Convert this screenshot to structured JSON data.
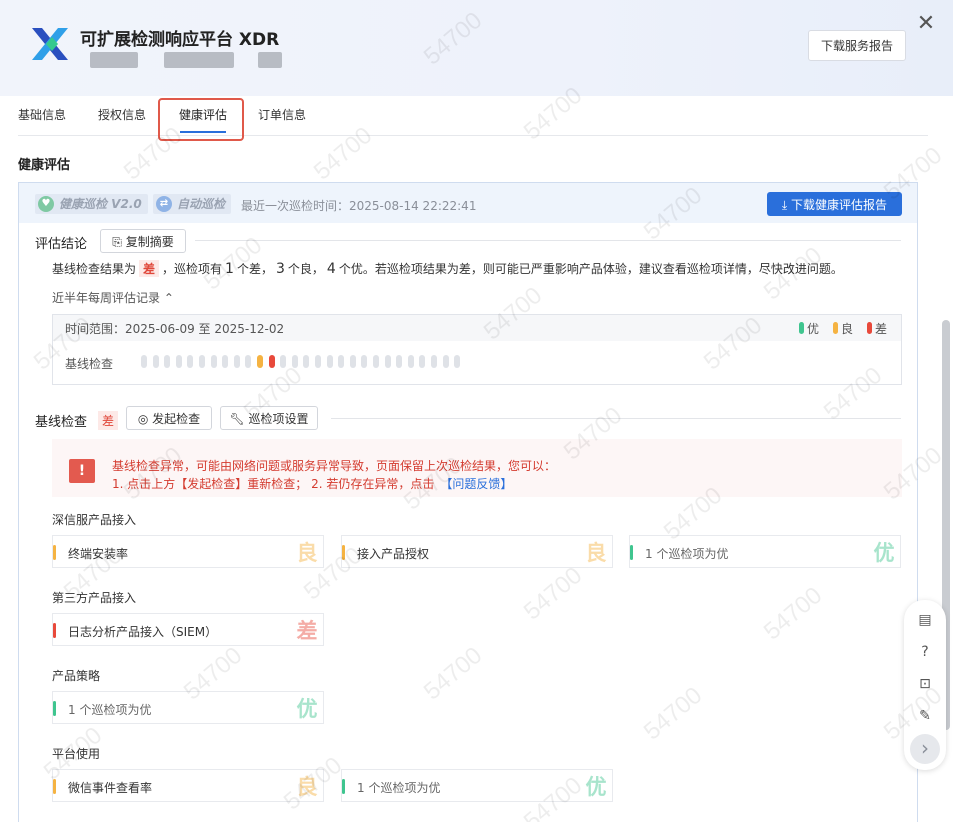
{
  "app": {
    "title": "可扩展检测响应平台 XDR",
    "download_service_report": "下载服务报告",
    "close_symbol": "✕"
  },
  "tabs": [
    {
      "label": "基础信息"
    },
    {
      "label": "授权信息"
    },
    {
      "label": "健康评估"
    },
    {
      "label": "订单信息"
    }
  ],
  "section_title": "健康评估",
  "panel": {
    "badge_patrol": "健康巡检 V2.0",
    "badge_auto": "自动巡检",
    "last_time": "最近一次巡检时间：2025-08-14 22:22:41",
    "download_report": "下载健康评估报告"
  },
  "conclusion": {
    "title": "评估结论",
    "copy_button": "复制摘要",
    "summary_prefix": "基线检查结果为",
    "summary_result": "差",
    "summary_mid1": "，巡检项有",
    "bad_count": "1",
    "summary_mid2": "个差，",
    "good_count": "3",
    "summary_mid3": "个良，",
    "excellent_count": "4",
    "summary_suffix": "个优。若巡检项结果为差，则可能已严重影响产品体验，建议查看巡检项详情，尽快改进问题。"
  },
  "history": {
    "toggle_label": "近半年每周评估记录 ⌃",
    "range": "时间范围：2025-06-09 至 2025-12-02",
    "legend": [
      {
        "label": "优",
        "color": "#3fc58f"
      },
      {
        "label": "良",
        "color": "#f5b342"
      },
      {
        "label": "差",
        "color": "#e8493b"
      }
    ],
    "row_label": "基线检查",
    "weeks": [
      "none",
      "none",
      "none",
      "none",
      "none",
      "none",
      "none",
      "none",
      "none",
      "none",
      "good",
      "bad",
      "none",
      "none",
      "none",
      "none",
      "none",
      "none",
      "none",
      "none",
      "none",
      "none",
      "none",
      "none",
      "none",
      "none",
      "none",
      "none"
    ]
  },
  "baseline": {
    "title": "基线检查",
    "result": "差",
    "start_button": "发起检查",
    "settings_button": "巡检项设置",
    "alert_icon": "!",
    "alert_line1": "基线检查异常，可能由网络问题或服务异常导致，页面保留上次巡检结果，您可以：",
    "alert_line2": "1. 点击上方【发起检查】重新检查； 2. 若仍存在异常，点击",
    "alert_link": "【问题反馈】"
  },
  "groups": [
    {
      "title": "深信服产品接入",
      "cards": [
        {
          "text": "终端安装率",
          "grade": "良",
          "level": "good"
        },
        {
          "text": "接入产品授权",
          "grade": "良",
          "level": "good"
        },
        {
          "text": "1 个巡检项为优",
          "grade": "优",
          "level": "excellent"
        }
      ]
    },
    {
      "title": "第三方产品接入",
      "cards": [
        {
          "text": "日志分析产品接入（SIEM）",
          "grade": "差",
          "level": "bad"
        }
      ]
    },
    {
      "title": "产品策略",
      "cards": [
        {
          "text": "1 个巡检项为优",
          "grade": "优",
          "level": "excellent"
        }
      ]
    },
    {
      "title": "平台使用",
      "cards": [
        {
          "text": "微信事件查看率",
          "grade": "良",
          "level": "good"
        },
        {
          "text": "1 个巡检项为优",
          "grade": "优",
          "level": "excellent"
        }
      ]
    }
  ],
  "level_colors": {
    "excellent": "#3fc58f",
    "good": "#f5b342",
    "bad": "#e8493b",
    "none": "#dfe2e7"
  },
  "float_tools": {
    "doc_icon": "▤",
    "help_icon": "?",
    "lock_icon": "⊡",
    "edit_icon": "✎",
    "next_icon": "›"
  },
  "watermark": "54700"
}
